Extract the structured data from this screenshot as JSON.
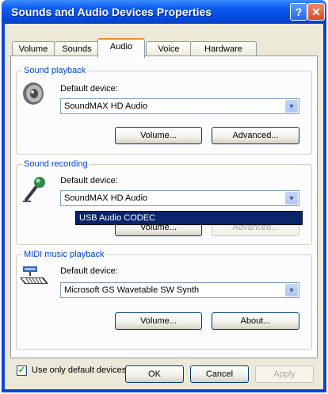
{
  "window": {
    "title": "Sounds and Audio Devices Properties",
    "help_glyph": "?",
    "close_glyph": "✕"
  },
  "tabs": [
    {
      "label": "Volume"
    },
    {
      "label": "Sounds"
    },
    {
      "label": "Audio",
      "active": true
    },
    {
      "label": "Voice"
    },
    {
      "label": "Hardware"
    }
  ],
  "playback": {
    "group_label": "Sound playback",
    "device_label": "Default device:",
    "selected_device": "SoundMAX HD Audio",
    "volume_button": "Volume...",
    "advanced_button": "Advanced..."
  },
  "recording": {
    "group_label": "Sound recording",
    "device_label": "Default device:",
    "selected_device": "SoundMAX HD Audio",
    "dropdown_options": [
      "USB Audio CODEC"
    ],
    "volume_button": "Volume...",
    "advanced_button": "Advanced..."
  },
  "midi": {
    "group_label": "MIDI music playback",
    "device_label": "Default device:",
    "selected_device": "Microsoft GS Wavetable SW Synth",
    "volume_button": "Volume...",
    "about_button": "About..."
  },
  "options": {
    "use_only_default_devices": "Use only default devices",
    "checked": true
  },
  "footer": {
    "ok_label": "OK",
    "cancel_label": "Cancel",
    "apply_label": "Apply"
  },
  "colors": {
    "title_bar": "#0a5cf0",
    "group_label": "#0046d5",
    "selection": "#0a246a",
    "dialog_bg": "#ece9d8"
  }
}
